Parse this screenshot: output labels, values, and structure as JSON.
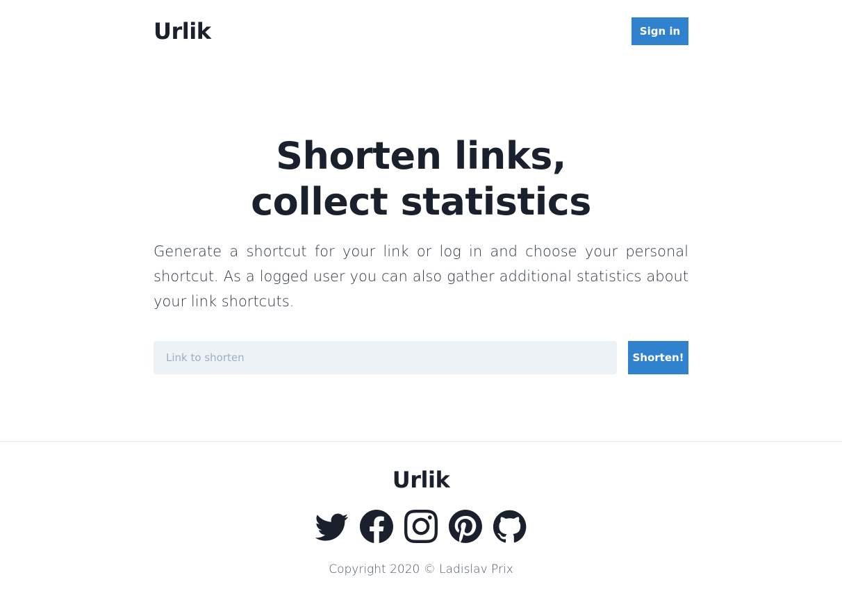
{
  "header": {
    "logo": "Urlik",
    "signin_label": "Sign in"
  },
  "hero": {
    "title": "Shorten links, collect statistics",
    "description": "Generate a shortcut for your link or log in and choose your personal shortcut. As a logged user you can also gather additional statistics about your link shortcuts."
  },
  "form": {
    "input_placeholder": "Link to shorten",
    "input_value": "",
    "submit_label": "Shorten!"
  },
  "footer": {
    "logo": "Urlik",
    "socials": [
      "twitter-icon",
      "facebook-icon",
      "instagram-icon",
      "pinterest-icon",
      "github-icon"
    ],
    "copyright": "Copyright 2020 © Ladislav Prix"
  },
  "colors": {
    "accent": "#3182ce",
    "text": "#1a202c",
    "input_bg": "#edf2f7"
  }
}
